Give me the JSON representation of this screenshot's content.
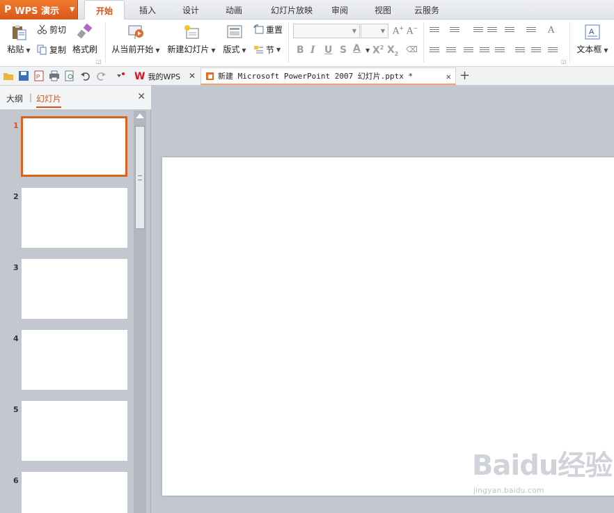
{
  "app": {
    "name": "WPS 演示",
    "logo": "P"
  },
  "menu_tabs": [
    "开始",
    "插入",
    "设计",
    "动画",
    "幻灯片放映",
    "审阅",
    "视图",
    "云服务"
  ],
  "ribbon": {
    "paste": "粘贴",
    "cut": "剪切",
    "copy": "复制",
    "format_painter": "格式刷",
    "from_current": "从当前开始",
    "new_slide": "新建幻灯片",
    "layout": "版式",
    "reset": "重置",
    "section": "节",
    "textbox": "文本框"
  },
  "doc_tabs": {
    "home": "我的WPS",
    "document": "新建 Microsoft PowerPoint 2007 幻灯片.pptx *"
  },
  "pane": {
    "outline_tab": "大纲",
    "slides_tab": "幻灯片",
    "slide_numbers": [
      "1",
      "2",
      "3",
      "4",
      "5",
      "6"
    ]
  },
  "watermark": {
    "logo": "Baidu经验",
    "url": "jingyan.baidu.com"
  },
  "colors": {
    "accent": "#d8541a",
    "app_orange": "#e56a24",
    "workspace": "#c3c7d0"
  }
}
